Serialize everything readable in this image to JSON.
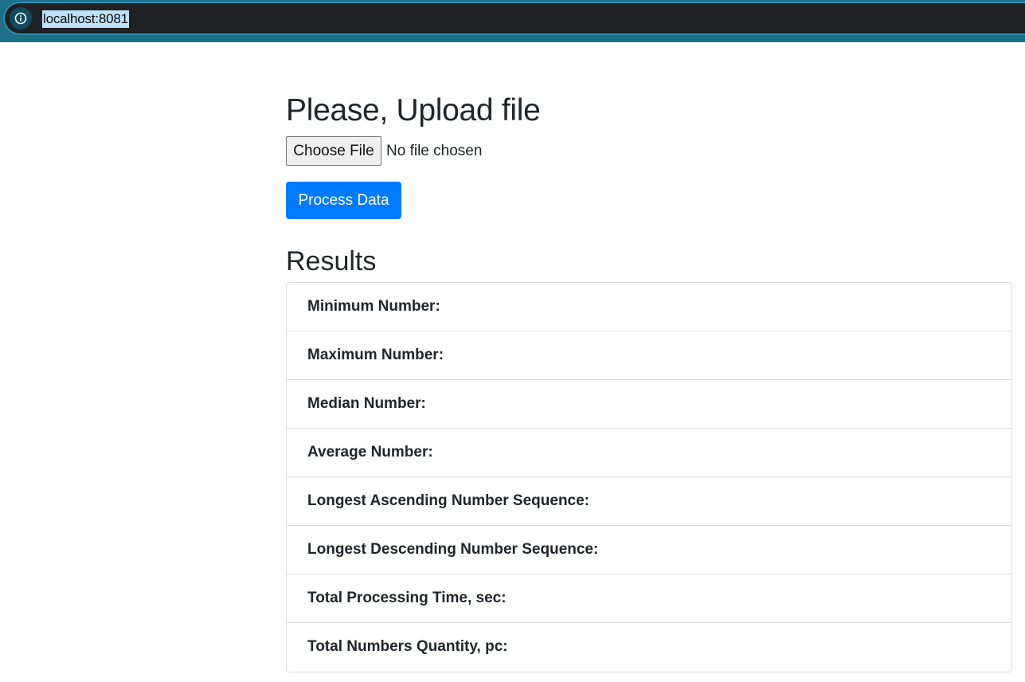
{
  "browser": {
    "url": "localhost:8081",
    "info_icon": "info-icon"
  },
  "page": {
    "title": "Please, Upload file",
    "file_input": {
      "button_label": "Choose File",
      "status": "No file chosen"
    },
    "process_button": "Process Data",
    "results_title": "Results",
    "results": [
      {
        "label": "Minimum Number:",
        "value": ""
      },
      {
        "label": "Maximum Number:",
        "value": ""
      },
      {
        "label": "Median Number:",
        "value": ""
      },
      {
        "label": "Average Number:",
        "value": ""
      },
      {
        "label": "Longest Ascending Number Sequence:",
        "value": ""
      },
      {
        "label": "Longest Descending Number Sequence:",
        "value": ""
      },
      {
        "label": "Total Processing Time, sec:",
        "value": ""
      },
      {
        "label": "Total Numbers Quantity, pc:",
        "value": ""
      }
    ]
  },
  "colors": {
    "primary": "#007bff",
    "browser_bar": "#1b6f87",
    "omnibox": "#202124",
    "url_highlight": "#bfe3fb"
  }
}
